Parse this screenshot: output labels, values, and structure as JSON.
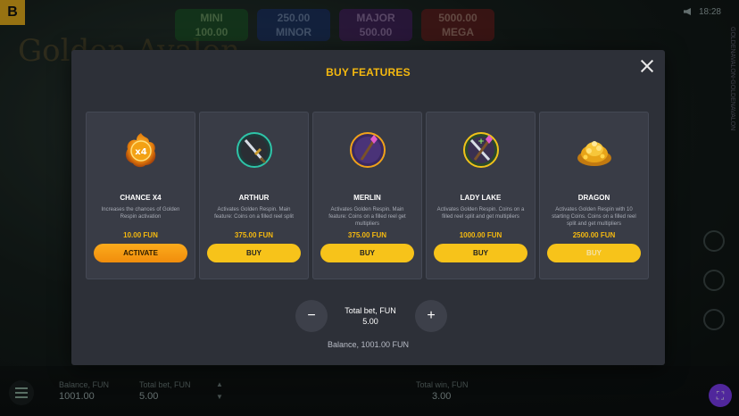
{
  "background": {
    "logo_letter": "B",
    "game_title": "Golden Avalon",
    "jackpots": [
      {
        "tier": "MINI",
        "value": "100.00"
      },
      {
        "tier": "MINOR",
        "value": "250.00"
      },
      {
        "tier": "MAJOR",
        "value": "500.00"
      },
      {
        "tier": "MEGA",
        "value": "5000.00"
      }
    ],
    "clock": "18:28",
    "side_text": "GOLDENAVALON-GOLDENAVALON",
    "bottom": {
      "balance_label": "Balance, FUN",
      "balance_value": "1001.00",
      "total_bet_label": "Total bet, FUN",
      "total_bet_value": "5.00",
      "total_win_label": "Total win, FUN",
      "total_win_value": "3.00"
    }
  },
  "modal": {
    "title": "BUY FEATURES",
    "features": [
      {
        "name": "CHANCE X4",
        "description": "Increases the chances of Golden Respin activation",
        "price": "10.00 FUN",
        "button": "ACTIVATE",
        "icon": "chance-x4-icon"
      },
      {
        "name": "ARTHUR",
        "description": "Activates Golden Respin. Main feature: Coins on a filled reel split",
        "price": "375.00 FUN",
        "button": "BUY",
        "icon": "sword-icon"
      },
      {
        "name": "MERLIN",
        "description": "Activates Golden Respin. Main feature: Coins on a filled reel get multipliers",
        "price": "375.00 FUN",
        "button": "BUY",
        "icon": "wand-icon"
      },
      {
        "name": "LADY LAKE",
        "description": "Activates Golden Respin. Coins on a filled reel split and get multipliers",
        "price": "1000.00 FUN",
        "button": "BUY",
        "icon": "sword-and-wand-icon"
      },
      {
        "name": "DRAGON",
        "description": "Activates Golden Respin with 10 starting Coins. Coins on a filled reel split and get multipliers",
        "price": "2500.00 FUN",
        "button": "BUY",
        "icon": "gold-pile-icon"
      }
    ],
    "bet": {
      "label": "Total bet, FUN",
      "value": "5.00",
      "decrease": "−",
      "increase": "+"
    },
    "balance": "Balance, 1001.00 FUN"
  },
  "colors": {
    "accent": "#f5b90f",
    "activate": "#f7980f",
    "modal_bg": "#2d3038",
    "card_bg": "#393c46"
  }
}
